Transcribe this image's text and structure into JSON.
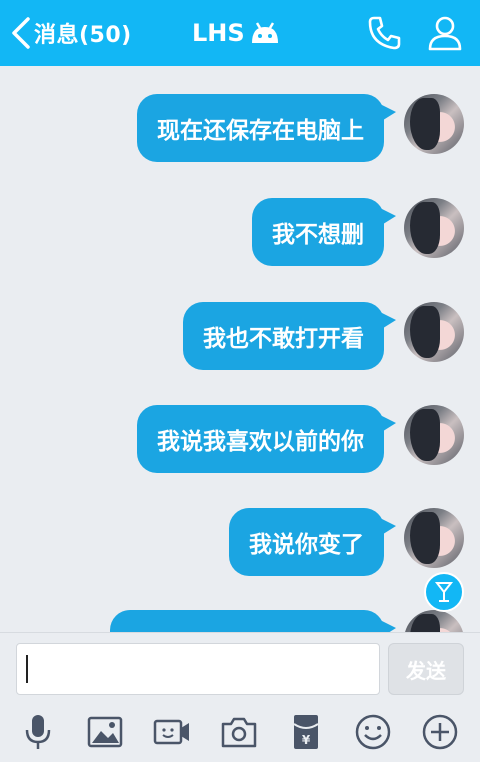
{
  "header": {
    "back_label": "消息(50)",
    "title": "LHS",
    "icons": [
      "chevron-left-icon",
      "android-icon",
      "phone-icon",
      "person-icon"
    ]
  },
  "messages": [
    {
      "text": "现在还保存在电脑上"
    },
    {
      "text": "我不想删"
    },
    {
      "text": "我也不敢打开看"
    },
    {
      "text": "我说我喜欢以前的你"
    },
    {
      "text": "我说你变了"
    }
  ],
  "input": {
    "value": "",
    "send_label": "发送"
  },
  "toolbar": {
    "icons": [
      "microphone-icon",
      "image-icon",
      "video-icon",
      "camera-icon",
      "red-packet-icon",
      "emoji-icon",
      "plus-icon"
    ]
  },
  "colors": {
    "accent": "#12b7f5",
    "bubble": "#1ba5e2",
    "background": "#eaedf1"
  }
}
